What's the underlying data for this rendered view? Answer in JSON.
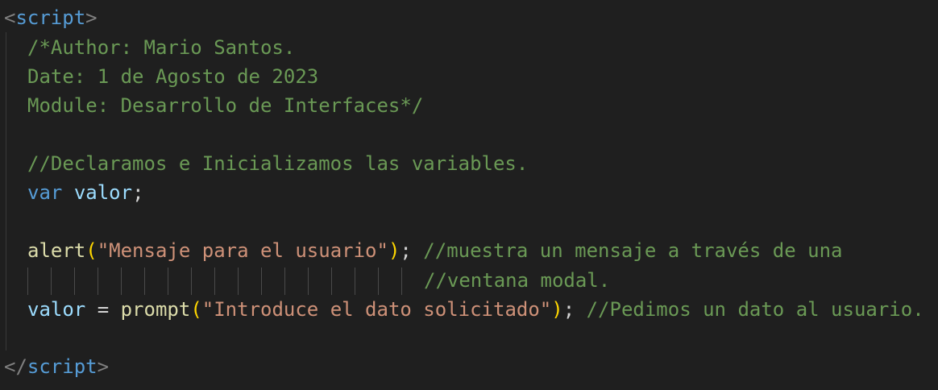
{
  "editor": {
    "background": "#1f1f1f",
    "colors": {
      "tag": "#569cd6",
      "comment": "#6a9955",
      "string": "#ce9178",
      "function": "#dcdcaa",
      "variable": "#9cdcfe",
      "paren": "#ffd700"
    },
    "open_tag": {
      "lt": "<",
      "name": "script",
      "gt": ">"
    },
    "comment_block": {
      "line1": "/*Author: Mario Santos.",
      "line2": "Date: 1 de Agosto de 2023",
      "line3": "Module: Desarrollo de Interfaces*/"
    },
    "declare_comment": "//Declaramos e Inicializamos las variables.",
    "var_line": {
      "keyword": "var",
      "name": "valor",
      "semicolon": ";"
    },
    "alert_line": {
      "fn": "alert",
      "open": "(",
      "arg": "\"Mensaje para el usuario\"",
      "close": ")",
      "semicolon": ";",
      "comment": "//muestra un mensaje a través de una"
    },
    "alert_wrap_comment": "//ventana modal.",
    "prompt_line": {
      "var": "valor",
      "op": " = ",
      "fn": "prompt",
      "open": "(",
      "arg": "\"Introduce el dato solicitado\"",
      "close": ")",
      "semicolon": ";",
      "comment": "//Pedimos un dato al usuario."
    },
    "close_tag": {
      "lt": "</",
      "name": "script",
      "gt": ">"
    }
  }
}
